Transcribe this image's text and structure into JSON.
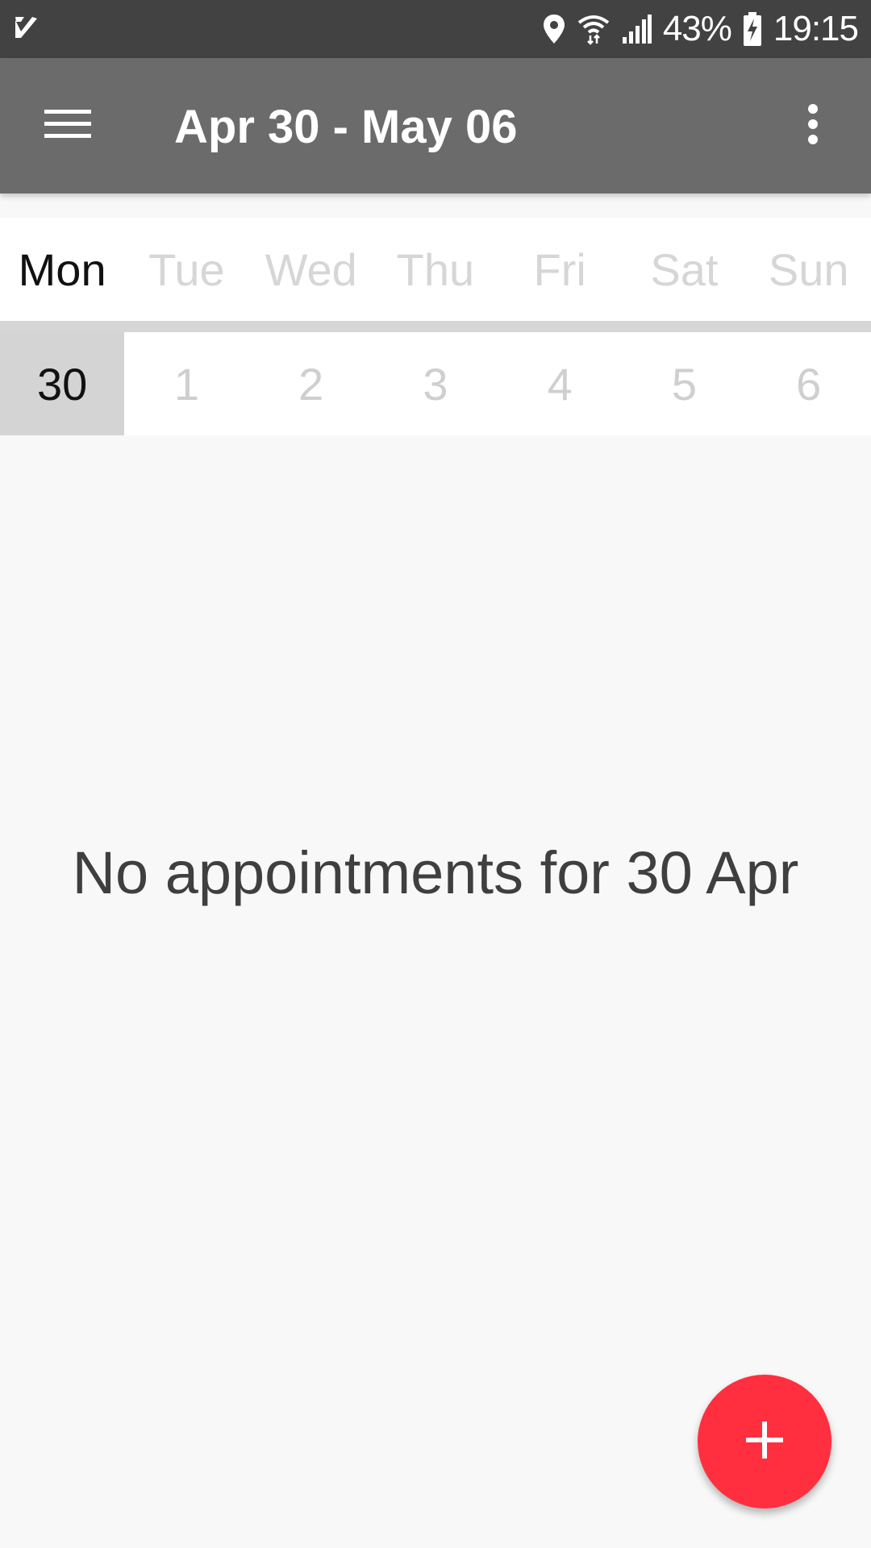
{
  "status_bar": {
    "battery_text": "43%",
    "time": "19:15",
    "icons": [
      "app-check-icon",
      "location-icon",
      "wifi-icon",
      "signal-icon",
      "battery-charging-icon"
    ]
  },
  "app_bar": {
    "title": "Apr 30 - May 06",
    "menu_icon": "hamburger-menu-icon",
    "overflow_icon": "more-vert-icon",
    "background": "#6b6b6b"
  },
  "week": {
    "days": [
      {
        "name": "Mon",
        "date": "30",
        "active": true
      },
      {
        "name": "Tue",
        "date": "1",
        "active": false
      },
      {
        "name": "Wed",
        "date": "2",
        "active": false
      },
      {
        "name": "Thu",
        "date": "3",
        "active": false
      },
      {
        "name": "Fri",
        "date": "4",
        "active": false
      },
      {
        "name": "Sat",
        "date": "5",
        "active": false
      },
      {
        "name": "Sun",
        "date": "6",
        "active": false
      }
    ]
  },
  "main": {
    "empty_message": "No appointments for 30 Apr"
  },
  "fab": {
    "icon": "plus-icon",
    "color": "#ff2f3f"
  }
}
